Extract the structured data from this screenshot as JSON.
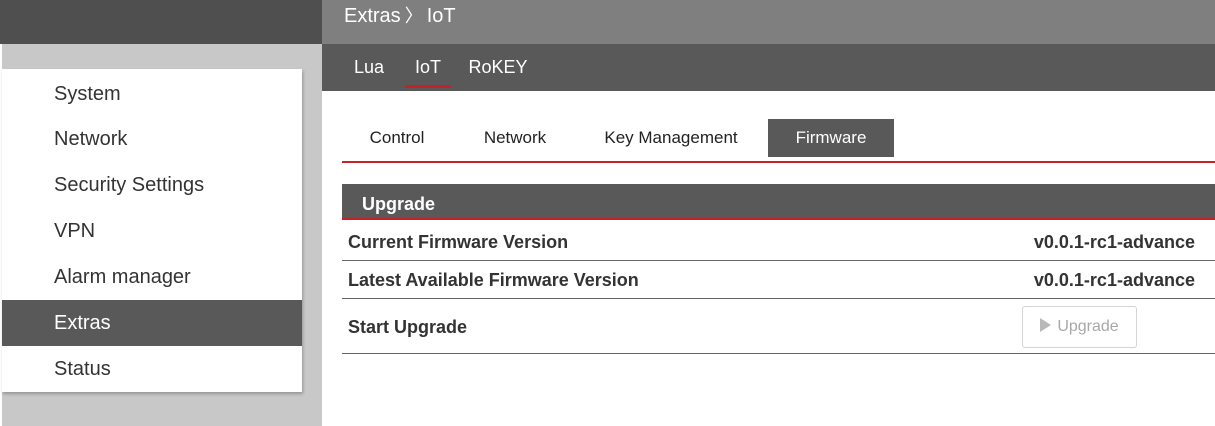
{
  "breadcrumb": {
    "parent": "Extras",
    "separator": "〉",
    "current": "IoT"
  },
  "sidebar": {
    "items": [
      {
        "label": "System"
      },
      {
        "label": "Network"
      },
      {
        "label": "Security Settings"
      },
      {
        "label": "VPN"
      },
      {
        "label": "Alarm manager"
      },
      {
        "label": "Extras",
        "active": true
      },
      {
        "label": "Status"
      }
    ]
  },
  "subnav": {
    "tabs": [
      {
        "label": "Lua"
      },
      {
        "label": "IoT",
        "active": true
      },
      {
        "label": "RoKEY"
      }
    ]
  },
  "content_tabs": [
    {
      "label": "Control"
    },
    {
      "label": "Network"
    },
    {
      "label": "Key Management"
    },
    {
      "label": "Firmware",
      "active": true
    }
  ],
  "upgrade_section": {
    "title": "Upgrade",
    "rows": [
      {
        "label": "Current Firmware Version",
        "value": "v0.0.1-rc1-advance"
      },
      {
        "label": "Latest Available Firmware Version",
        "value": "v0.0.1-rc1-advance"
      },
      {
        "label": "Start Upgrade"
      }
    ],
    "upgrade_button": {
      "label": "Upgrade",
      "icon": "play-icon",
      "disabled": true
    }
  },
  "colors": {
    "accent": "#c62127",
    "dark_bar": "#595959",
    "header_bar": "#7f7f7f"
  }
}
